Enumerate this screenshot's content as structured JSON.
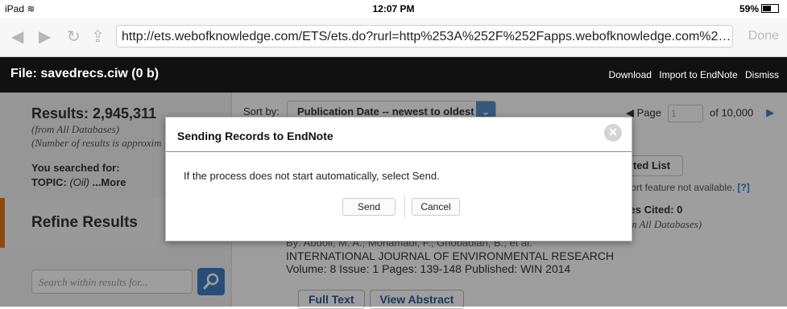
{
  "status": {
    "device": "iPad",
    "time": "12:07 PM",
    "battery": "59%"
  },
  "browser": {
    "url": "http://ets.webofknowledge.com/ETS/ets.do?rurl=http%253A%252F%252Fapps.webofknowledge.com%252Fsu...",
    "done_label": "Done",
    "back_icon": "◀",
    "forward_icon": "▶",
    "reload_icon": "↻",
    "share_icon": "⇪"
  },
  "filebar": {
    "title": "File: savedrecs.ciw (0 b)",
    "actions": [
      "Download",
      "Import to EndNote",
      "Dismiss"
    ]
  },
  "sidebar": {
    "results": "Results: 2,945,311",
    "from": "(from All Databases)",
    "approx": "(Number of results is approxim",
    "searched_label": "You searched for:",
    "topic_prefix": "TOPIC: ",
    "topic_value": "(Oil)",
    "more": " ...More",
    "refine": "Refine Results",
    "search_placeholder": "Search within results for..."
  },
  "main": {
    "sort_label": "Sort by:",
    "sort_value": "Publication Date -- newest to oldest",
    "page_label": "Page",
    "page_value": "1",
    "page_of": "of 10,000",
    "saved_list": "ted List",
    "report_note": "eport feature not available.",
    "report_help": "[?]",
    "times_cited": "mes Cited: 0",
    "times_db": "rom All Databases)",
    "authors": "By: Abdoli, M. A.; Mohamadi, F.; Ghobadian, B.; et al.",
    "journal": "INTERNATIONAL JOURNAL OF ENVIRONMENTAL RESEARCH  Volume: 8  Issue: 1  Pages: 139-148  Published: WIN 2014",
    "full_text": "Full Text",
    "view_abstract": "View Abstract"
  },
  "modal": {
    "title": "Sending Records to EndNote",
    "message": "If the process does not start automatically, select Send.",
    "send": "Send",
    "cancel": "Cancel",
    "close_icon": "×"
  }
}
